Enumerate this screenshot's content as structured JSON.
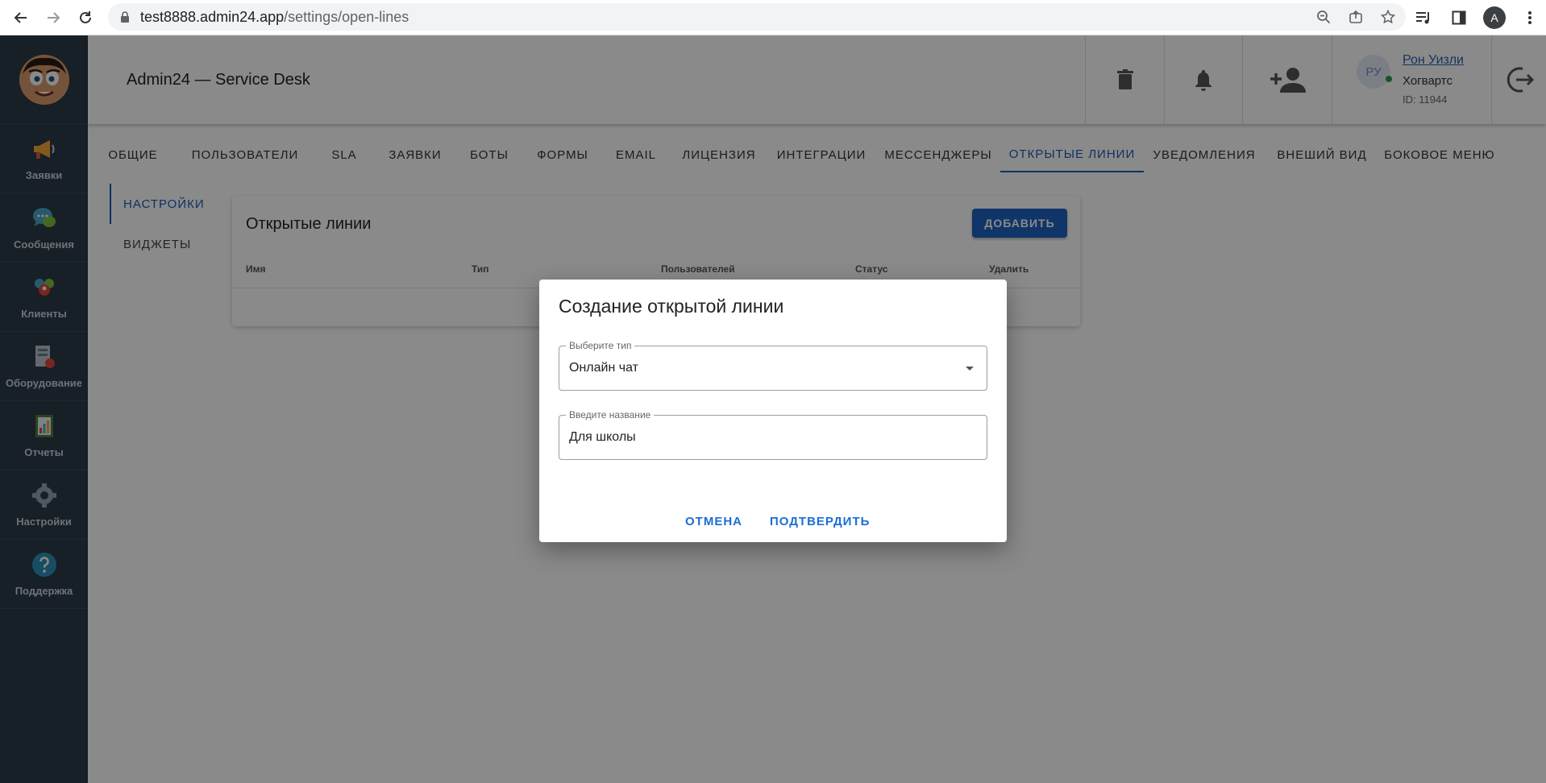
{
  "browser": {
    "url_host": "test8888.admin24.app",
    "url_path": "/settings/open-lines",
    "profile_initial": "A"
  },
  "sidebar": {
    "items": [
      {
        "label": "Заявки",
        "icon": "megaphone-icon"
      },
      {
        "label": "Сообщения",
        "icon": "chat-bubble-icon"
      },
      {
        "label": "Клиенты",
        "icon": "people-icon"
      },
      {
        "label": "Оборудование",
        "icon": "equipment-icon"
      },
      {
        "label": "Отчеты",
        "icon": "report-icon"
      },
      {
        "label": "Настройки",
        "icon": "gear-icon"
      },
      {
        "label": "Поддержка",
        "icon": "help-icon"
      }
    ]
  },
  "header": {
    "title": "Admin24 — Service Desk",
    "user": {
      "initials": "РУ",
      "name": "Рон Уизли",
      "org": "Хогвартс",
      "id": "ID: 11944"
    }
  },
  "tabs": [
    "ОБЩИЕ",
    "ПОЛЬЗОВАТЕЛИ",
    "SLA",
    "ЗАЯВКИ",
    "БОТЫ",
    "ФОРМЫ",
    "EMAIL",
    "ЛИЦЕНЗИЯ",
    "ИНТЕГРАЦИИ",
    "МЕССЕНДЖЕРЫ",
    "ОТКРЫТЫЕ ЛИНИИ",
    "УВЕДОМЛЕНИЯ",
    "ВНЕШИЙ ВИД",
    "БОКОВОЕ МЕНЮ"
  ],
  "active_tab": "ОТКРЫТЫЕ ЛИНИИ",
  "sub_menu": {
    "items": [
      "НАСТРОЙКИ",
      "ВИДЖЕТЫ"
    ]
  },
  "card": {
    "title": "Открытые линии",
    "add_label": "ДОБАВИТЬ",
    "columns": [
      "Имя",
      "Тип",
      "Пользователей",
      "Статус",
      "Удалить"
    ]
  },
  "dialog": {
    "title": "Создание открытой линии",
    "type_field": {
      "label": "Выберите тип",
      "value": "Онлайн чат"
    },
    "name_field": {
      "label": "Введите название",
      "value": "Для школы"
    },
    "cancel_label": "ОТМЕНА",
    "confirm_label": "ПОДТВЕРДИТЬ"
  },
  "colors": {
    "sidebar_bg": "#2b3a48",
    "accent": "#1a5cb5",
    "add_button": "#1e63c0",
    "dialog_button": "#1a6fd6",
    "online": "#2e9b4f"
  }
}
